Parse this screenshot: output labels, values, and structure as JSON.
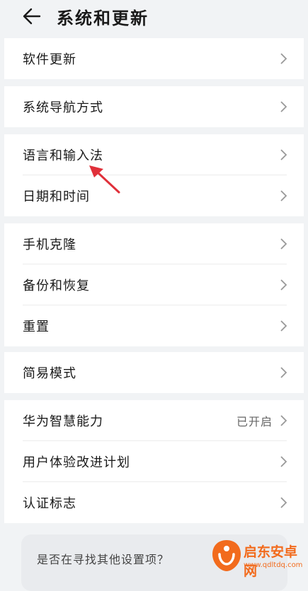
{
  "header": {
    "title": "系统和更新"
  },
  "groups": [
    {
      "items": [
        {
          "label": "软件更新"
        }
      ]
    },
    {
      "items": [
        {
          "label": "系统导航方式"
        }
      ]
    },
    {
      "items": [
        {
          "label": "语言和输入法"
        },
        {
          "label": "日期和时间"
        }
      ]
    },
    {
      "items": [
        {
          "label": "手机克隆"
        },
        {
          "label": "备份和恢复"
        },
        {
          "label": "重置"
        }
      ]
    },
    {
      "items": [
        {
          "label": "简易模式"
        }
      ]
    },
    {
      "items": [
        {
          "label": "华为智慧能力",
          "value": "已开启"
        },
        {
          "label": "用户体验改进计划"
        },
        {
          "label": "认证标志"
        }
      ]
    }
  ],
  "suggestion": {
    "text": "是否在寻找其他设置项？"
  },
  "watermark": {
    "name": "启东安卓网",
    "url": "www.qdltdq.com"
  },
  "colors": {
    "accent": "#f26b1d",
    "arrow": "#e0303a",
    "background": "#f1f3f5"
  }
}
